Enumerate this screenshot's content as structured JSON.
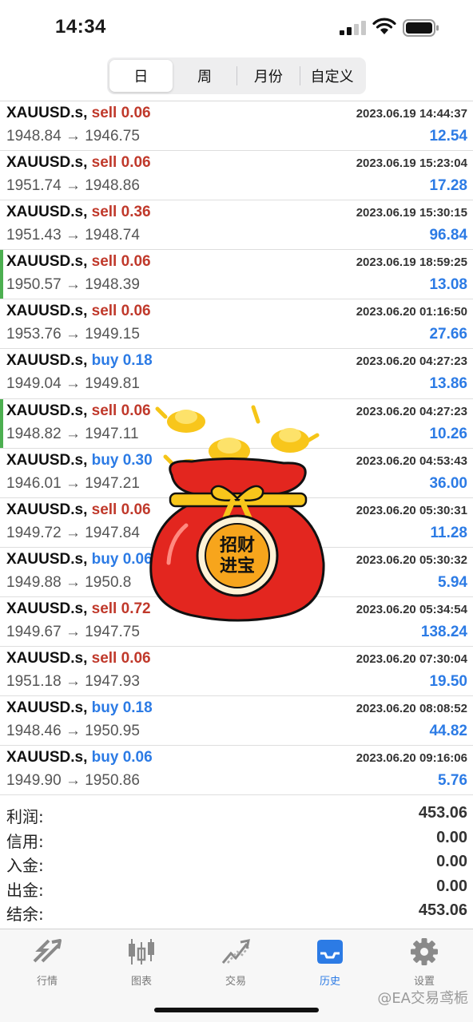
{
  "status_bar": {
    "time": "14:34"
  },
  "segment": {
    "tabs": [
      "日",
      "周",
      "月份",
      "自定义"
    ],
    "active_index": 0
  },
  "trades": [
    {
      "symbol": "XAUUSD.s,",
      "side": "sell",
      "volume": "0.06",
      "time": "2023.06.19 14:44:37",
      "prices": "1948.84 → 1946.75",
      "profit": "12.54",
      "marked": false
    },
    {
      "symbol": "XAUUSD.s,",
      "side": "sell",
      "volume": "0.06",
      "time": "2023.06.19 15:23:04",
      "prices": "1951.74 → 1948.86",
      "profit": "17.28",
      "marked": false
    },
    {
      "symbol": "XAUUSD.s,",
      "side": "sell",
      "volume": "0.36",
      "time": "2023.06.19 15:30:15",
      "prices": "1951.43 → 1948.74",
      "profit": "96.84",
      "marked": false
    },
    {
      "symbol": "XAUUSD.s,",
      "side": "sell",
      "volume": "0.06",
      "time": "2023.06.19 18:59:25",
      "prices": "1950.57 → 1948.39",
      "profit": "13.08",
      "marked": true
    },
    {
      "symbol": "XAUUSD.s,",
      "side": "sell",
      "volume": "0.06",
      "time": "2023.06.20 01:16:50",
      "prices": "1953.76 → 1949.15",
      "profit": "27.66",
      "marked": false
    },
    {
      "symbol": "XAUUSD.s,",
      "side": "buy",
      "volume": "0.18",
      "time": "2023.06.20 04:27:23",
      "prices": "1949.04 → 1949.81",
      "profit": "13.86",
      "marked": false
    },
    {
      "symbol": "XAUUSD.s,",
      "side": "sell",
      "volume": "0.06",
      "time": "2023.06.20 04:27:23",
      "prices": "1948.82 → 1947.11",
      "profit": "10.26",
      "marked": true
    },
    {
      "symbol": "XAUUSD.s,",
      "side": "buy",
      "volume": "0.30",
      "time": "2023.06.20 04:53:43",
      "prices": "1946.01 → 1947.21",
      "profit": "36.00",
      "marked": false
    },
    {
      "symbol": "XAUUSD.s,",
      "side": "sell",
      "volume": "0.06",
      "time": "2023.06.20 05:30:31",
      "prices": "1949.72 → 1947.84",
      "profit": "11.28",
      "marked": false
    },
    {
      "symbol": "XAUUSD.s,",
      "side": "buy",
      "volume": "0.06",
      "time": "2023.06.20 05:30:32",
      "prices": "1949.88 → 1950.8",
      "profit": "5.94",
      "marked": false
    },
    {
      "symbol": "XAUUSD.s,",
      "side": "sell",
      "volume": "0.72",
      "time": "2023.06.20 05:34:54",
      "prices": "1949.67 → 1947.75",
      "profit": "138.24",
      "marked": false
    },
    {
      "symbol": "XAUUSD.s,",
      "side": "sell",
      "volume": "0.06",
      "time": "2023.06.20 07:30:04",
      "prices": "1951.18 → 1947.93",
      "profit": "19.50",
      "marked": false
    },
    {
      "symbol": "XAUUSD.s,",
      "side": "buy",
      "volume": "0.18",
      "time": "2023.06.20 08:08:52",
      "prices": "1948.46 → 1950.95",
      "profit": "44.82",
      "marked": false
    },
    {
      "symbol": "XAUUSD.s,",
      "side": "buy",
      "volume": "0.06",
      "time": "2023.06.20 09:16:06",
      "prices": "1949.90 → 1950.86",
      "profit": "5.76",
      "marked": false
    }
  ],
  "summary": [
    {
      "label": "利润:",
      "value": "453.06"
    },
    {
      "label": "信用:",
      "value": "0.00"
    },
    {
      "label": "入金:",
      "value": "0.00"
    },
    {
      "label": "出金:",
      "value": "0.00"
    },
    {
      "label": "结余:",
      "value": "453.06"
    }
  ],
  "sticker": {
    "text_line1": "招财",
    "text_line2": "进宝"
  },
  "tab_bar": {
    "tabs": [
      {
        "label": "行情",
        "icon": "quotes-icon"
      },
      {
        "label": "图表",
        "icon": "chart-icon"
      },
      {
        "label": "交易",
        "icon": "trade-icon"
      },
      {
        "label": "历史",
        "icon": "history-icon"
      },
      {
        "label": "设置",
        "icon": "settings-icon"
      }
    ],
    "active_index": 3
  },
  "watermark": "@EA交易鸢栀",
  "colors": {
    "sell": "#c0392b",
    "buy": "#2c7be5",
    "profit": "#2c7be5",
    "marker": "#4caf50",
    "active_tab": "#2c7be5"
  }
}
